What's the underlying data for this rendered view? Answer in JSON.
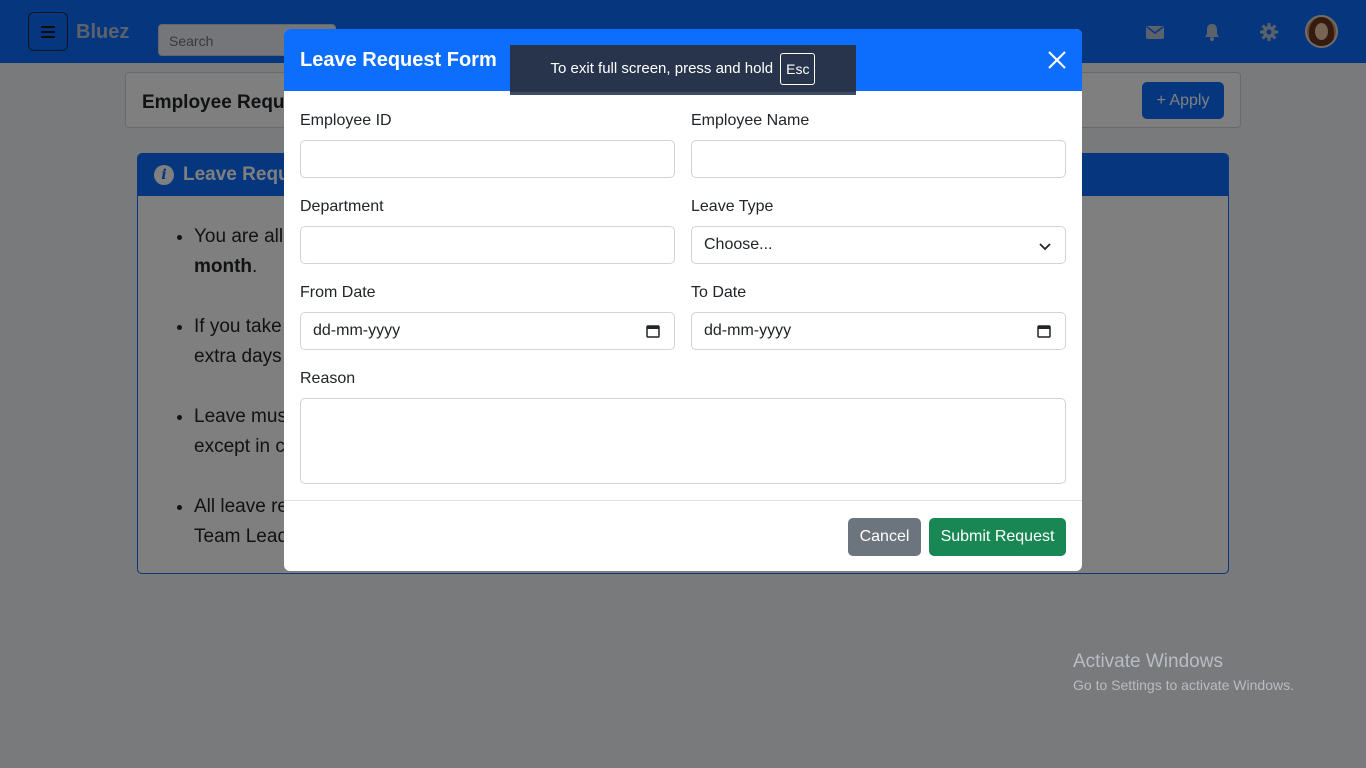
{
  "navbar": {
    "brand": "Bluez",
    "search_placeholder": "Search",
    "icons": [
      "menu-icon",
      "mail-icon",
      "bell-icon",
      "gear-icon",
      "avatar"
    ]
  },
  "page": {
    "title": "Employee Requ",
    "apply_label": "+ Apply"
  },
  "info_card": {
    "title": "Leave Requ",
    "rules": [
      {
        "line1": "You are all",
        "line2_bold": "month",
        "line2_rest": "."
      },
      {
        "line1": "If you take",
        "line2": "extra days"
      },
      {
        "line1": "Leave mus",
        "line2": "except in c"
      },
      {
        "line1": "All leave re",
        "line2": "Team Lead"
      }
    ]
  },
  "modal": {
    "title": "Leave Request Form",
    "fields": {
      "employee_id": {
        "label": "Employee ID",
        "value": ""
      },
      "employee_name": {
        "label": "Employee Name",
        "value": ""
      },
      "department": {
        "label": "Department",
        "value": ""
      },
      "leave_type": {
        "label": "Leave Type",
        "value": "Choose..."
      },
      "from_date": {
        "label": "From Date",
        "value": "dd-mm-yyyy"
      },
      "to_date": {
        "label": "To Date",
        "value": "dd-mm-yyyy"
      },
      "reason": {
        "label": "Reason",
        "value": ""
      }
    },
    "cancel_label": "Cancel",
    "submit_label": "Submit Request"
  },
  "fullscreen_notice": {
    "text": "To exit full screen, press and hold",
    "key": "Esc"
  },
  "watermark": {
    "line1": "Activate Windows",
    "line2": "Go to Settings to activate Windows."
  },
  "colors": {
    "primary": "#0d6efd",
    "success": "#198754",
    "secondary": "#6c757d"
  }
}
